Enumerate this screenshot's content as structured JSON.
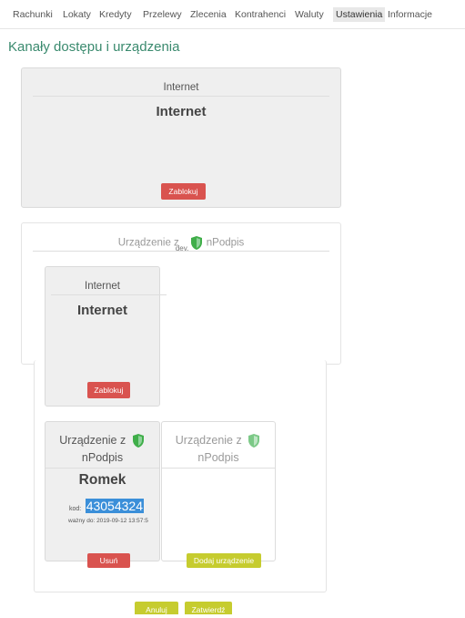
{
  "nav": {
    "items": [
      "Rachunki",
      "Lokaty",
      "Kredyty",
      "Przelewy",
      "Zlecenia",
      "Kontrahenci",
      "Waluty",
      "Ustawienia",
      "Informacje"
    ],
    "active_index": 7
  },
  "page": {
    "title": "Kanały dostępu i urządzenia"
  },
  "channel_top": {
    "header": "Internet",
    "name": "Internet",
    "block_label": "Zablokuj"
  },
  "device_group": {
    "header_prefix": "Urządzenie z",
    "header_overlap": "dev,",
    "header_suffix": "nPodpis"
  },
  "channel_overlay": {
    "header": "Internet",
    "name": "Internet",
    "block_label": "Zablokuj"
  },
  "device_card": {
    "header_line1": "Urządzenie z",
    "header_line2": "nPodpis",
    "name": "Romek",
    "code_label": "kod:",
    "code_value": "43054324",
    "valid_label": "ważny do: 2019-09-12 13:57:5",
    "remove_label": "Usuń"
  },
  "add_device_card": {
    "header_line1": "Urządzenie z",
    "header_line2": "nPodpis",
    "add_label": "Dodaj urządzenie"
  },
  "footer": {
    "cancel_label": "Anuluj",
    "confirm_label": "Zatwierdź"
  },
  "colors": {
    "accent_green": "#3a8a6e",
    "danger": "#d9534f",
    "olive": "#c6cc2f",
    "highlight_blue": "#3b8fd9",
    "shield_green": "#3fae49"
  },
  "icons": [
    "shield-check-icon"
  ]
}
